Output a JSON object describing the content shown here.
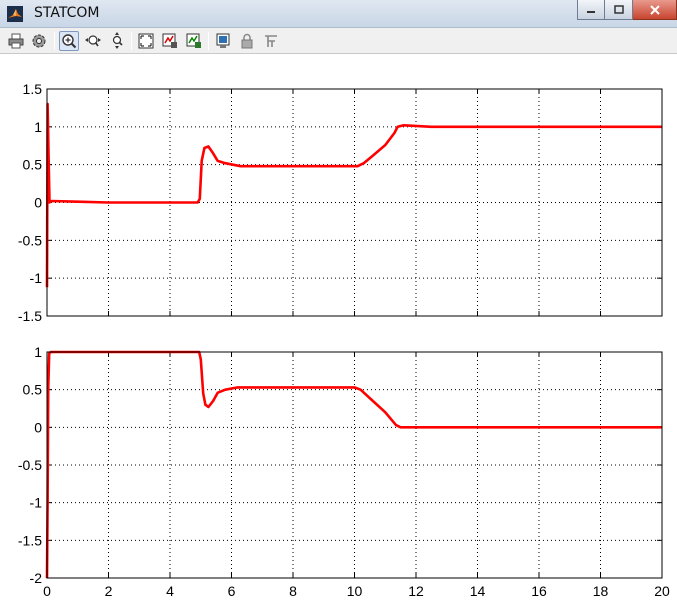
{
  "window": {
    "title": "STATCOM"
  },
  "toolbar": {
    "buttons": [
      {
        "icon": "printer-icon",
        "label": "Print"
      },
      {
        "icon": "gear-icon",
        "label": "Parameters"
      },
      {
        "icon": "zoom-in-icon",
        "label": "Zoom"
      },
      {
        "icon": "zoom-x-icon",
        "label": "Zoom X-axis"
      },
      {
        "icon": "zoom-y-icon",
        "label": "Zoom Y-axis"
      },
      {
        "icon": "autoscale-icon",
        "label": "Autoscale"
      },
      {
        "icon": "save-axes-icon",
        "label": "Save axes settings"
      },
      {
        "icon": "restore-axes-icon",
        "label": "Restore saved axes settings"
      },
      {
        "icon": "floating-scope-icon",
        "label": "Floating scope"
      },
      {
        "icon": "lock-icon",
        "label": "Lock axes selection"
      },
      {
        "icon": "signal-selection-icon",
        "label": "Signal selection"
      }
    ]
  },
  "colors": {
    "line": "#ff0000",
    "grid": "#000000",
    "background": "#ffffff"
  },
  "chart_data": [
    {
      "type": "line",
      "xlim": [
        0,
        20
      ],
      "ylim": [
        -1.5,
        1.5
      ],
      "xticks": [
        "0",
        "2",
        "4",
        "6",
        "8",
        "10",
        "12",
        "14",
        "16",
        "18",
        "20"
      ],
      "yticks": [
        "-1.5",
        "-1",
        "-0.5",
        "0",
        "0.5",
        "1",
        "1.5"
      ],
      "show_xtick_labels": false,
      "grid": true,
      "series": [
        {
          "color": "#ff0000",
          "points": [
            [
              0,
              -1.12
            ],
            [
              0.02,
              1.3
            ],
            [
              0.05,
              0.65
            ],
            [
              0.08,
              0.0
            ],
            [
              0.15,
              0.02
            ],
            [
              1,
              0.01
            ],
            [
              2,
              0.0
            ],
            [
              4.9,
              0.0
            ],
            [
              4.97,
              0.05
            ],
            [
              5.03,
              0.55
            ],
            [
              5.12,
              0.72
            ],
            [
              5.25,
              0.74
            ],
            [
              5.4,
              0.65
            ],
            [
              5.55,
              0.55
            ],
            [
              5.8,
              0.52
            ],
            [
              6.05,
              0.5
            ],
            [
              6.3,
              0.48
            ],
            [
              8,
              0.48
            ],
            [
              9.5,
              0.48
            ],
            [
              10.1,
              0.48
            ],
            [
              10.3,
              0.52
            ],
            [
              10.6,
              0.62
            ],
            [
              11.0,
              0.76
            ],
            [
              11.3,
              0.92
            ],
            [
              11.4,
              1.0
            ],
            [
              11.6,
              1.02
            ],
            [
              12.5,
              1.0
            ],
            [
              20,
              1.0
            ]
          ]
        }
      ]
    },
    {
      "type": "line",
      "xlim": [
        0,
        20
      ],
      "ylim": [
        -2,
        1
      ],
      "xticks": [
        "0",
        "2",
        "4",
        "6",
        "8",
        "10",
        "12",
        "14",
        "16",
        "18",
        "20"
      ],
      "yticks": [
        "-2",
        "-1.5",
        "-1",
        "-0.5",
        "0",
        "0.5",
        "1"
      ],
      "show_xtick_labels": true,
      "grid": true,
      "series": [
        {
          "color": "#ff0000",
          "points": [
            [
              0,
              -2.0
            ],
            [
              0.02,
              -1.0
            ],
            [
              0.04,
              0.5
            ],
            [
              0.07,
              0.98
            ],
            [
              0.12,
              1.0
            ],
            [
              4.95,
              1.0
            ],
            [
              5.0,
              0.9
            ],
            [
              5.08,
              0.45
            ],
            [
              5.15,
              0.3
            ],
            [
              5.25,
              0.27
            ],
            [
              5.4,
              0.35
            ],
            [
              5.55,
              0.46
            ],
            [
              5.8,
              0.5
            ],
            [
              6.2,
              0.53
            ],
            [
              8,
              0.53
            ],
            [
              10.0,
              0.53
            ],
            [
              10.2,
              0.5
            ],
            [
              10.6,
              0.35
            ],
            [
              11.0,
              0.2
            ],
            [
              11.35,
              0.03
            ],
            [
              11.5,
              0.0
            ],
            [
              20,
              0.0
            ]
          ]
        }
      ]
    }
  ]
}
